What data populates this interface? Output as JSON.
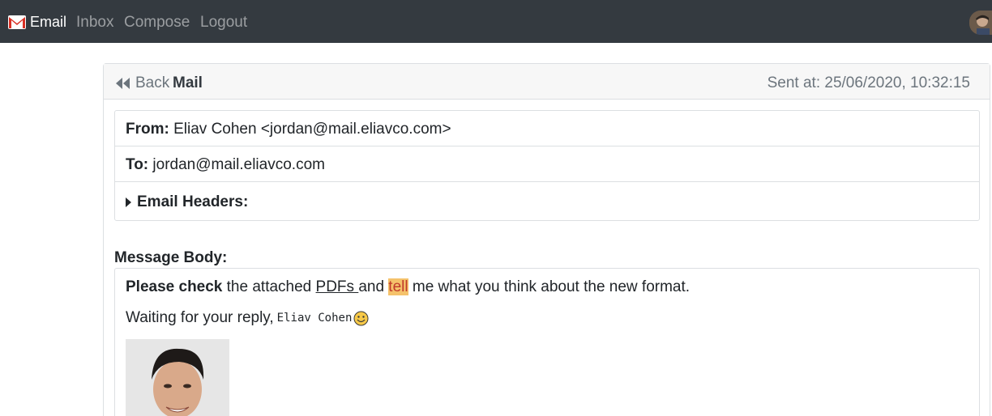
{
  "navbar": {
    "brand_label": "Email",
    "links": [
      "Inbox",
      "Compose",
      "Logout"
    ]
  },
  "card": {
    "back_label": "Back",
    "title": "Mail",
    "sent_at": "Sent at: 25/06/2020, 10:32:15"
  },
  "email": {
    "from_label": "From:",
    "from_value": "Eliav Cohen <jordan@mail.eliavco.com>",
    "to_label": "To:",
    "to_value": "jordan@mail.eliavco.com",
    "headers_label": "Email Headers:"
  },
  "message": {
    "label": "Message Body:",
    "line1_bold": "Please check",
    "line1_a": " the attached ",
    "line1_link": "PDFs ",
    "line1_b": "and ",
    "line1_highlight": "tell",
    "line1_c": " me what you think about the new format.",
    "line2_text": "Waiting for your reply,",
    "line2_mono": "Eliav Cohen"
  },
  "colors": {
    "navbar_bg": "#343a40",
    "highlight_bg": "#f5c26b",
    "highlight_text": "#c0392b"
  },
  "icons": {
    "brand": "gmail-icon",
    "back": "fast-backward-icon",
    "headers": "caret-right-icon",
    "emoji": "smiley-icon"
  }
}
